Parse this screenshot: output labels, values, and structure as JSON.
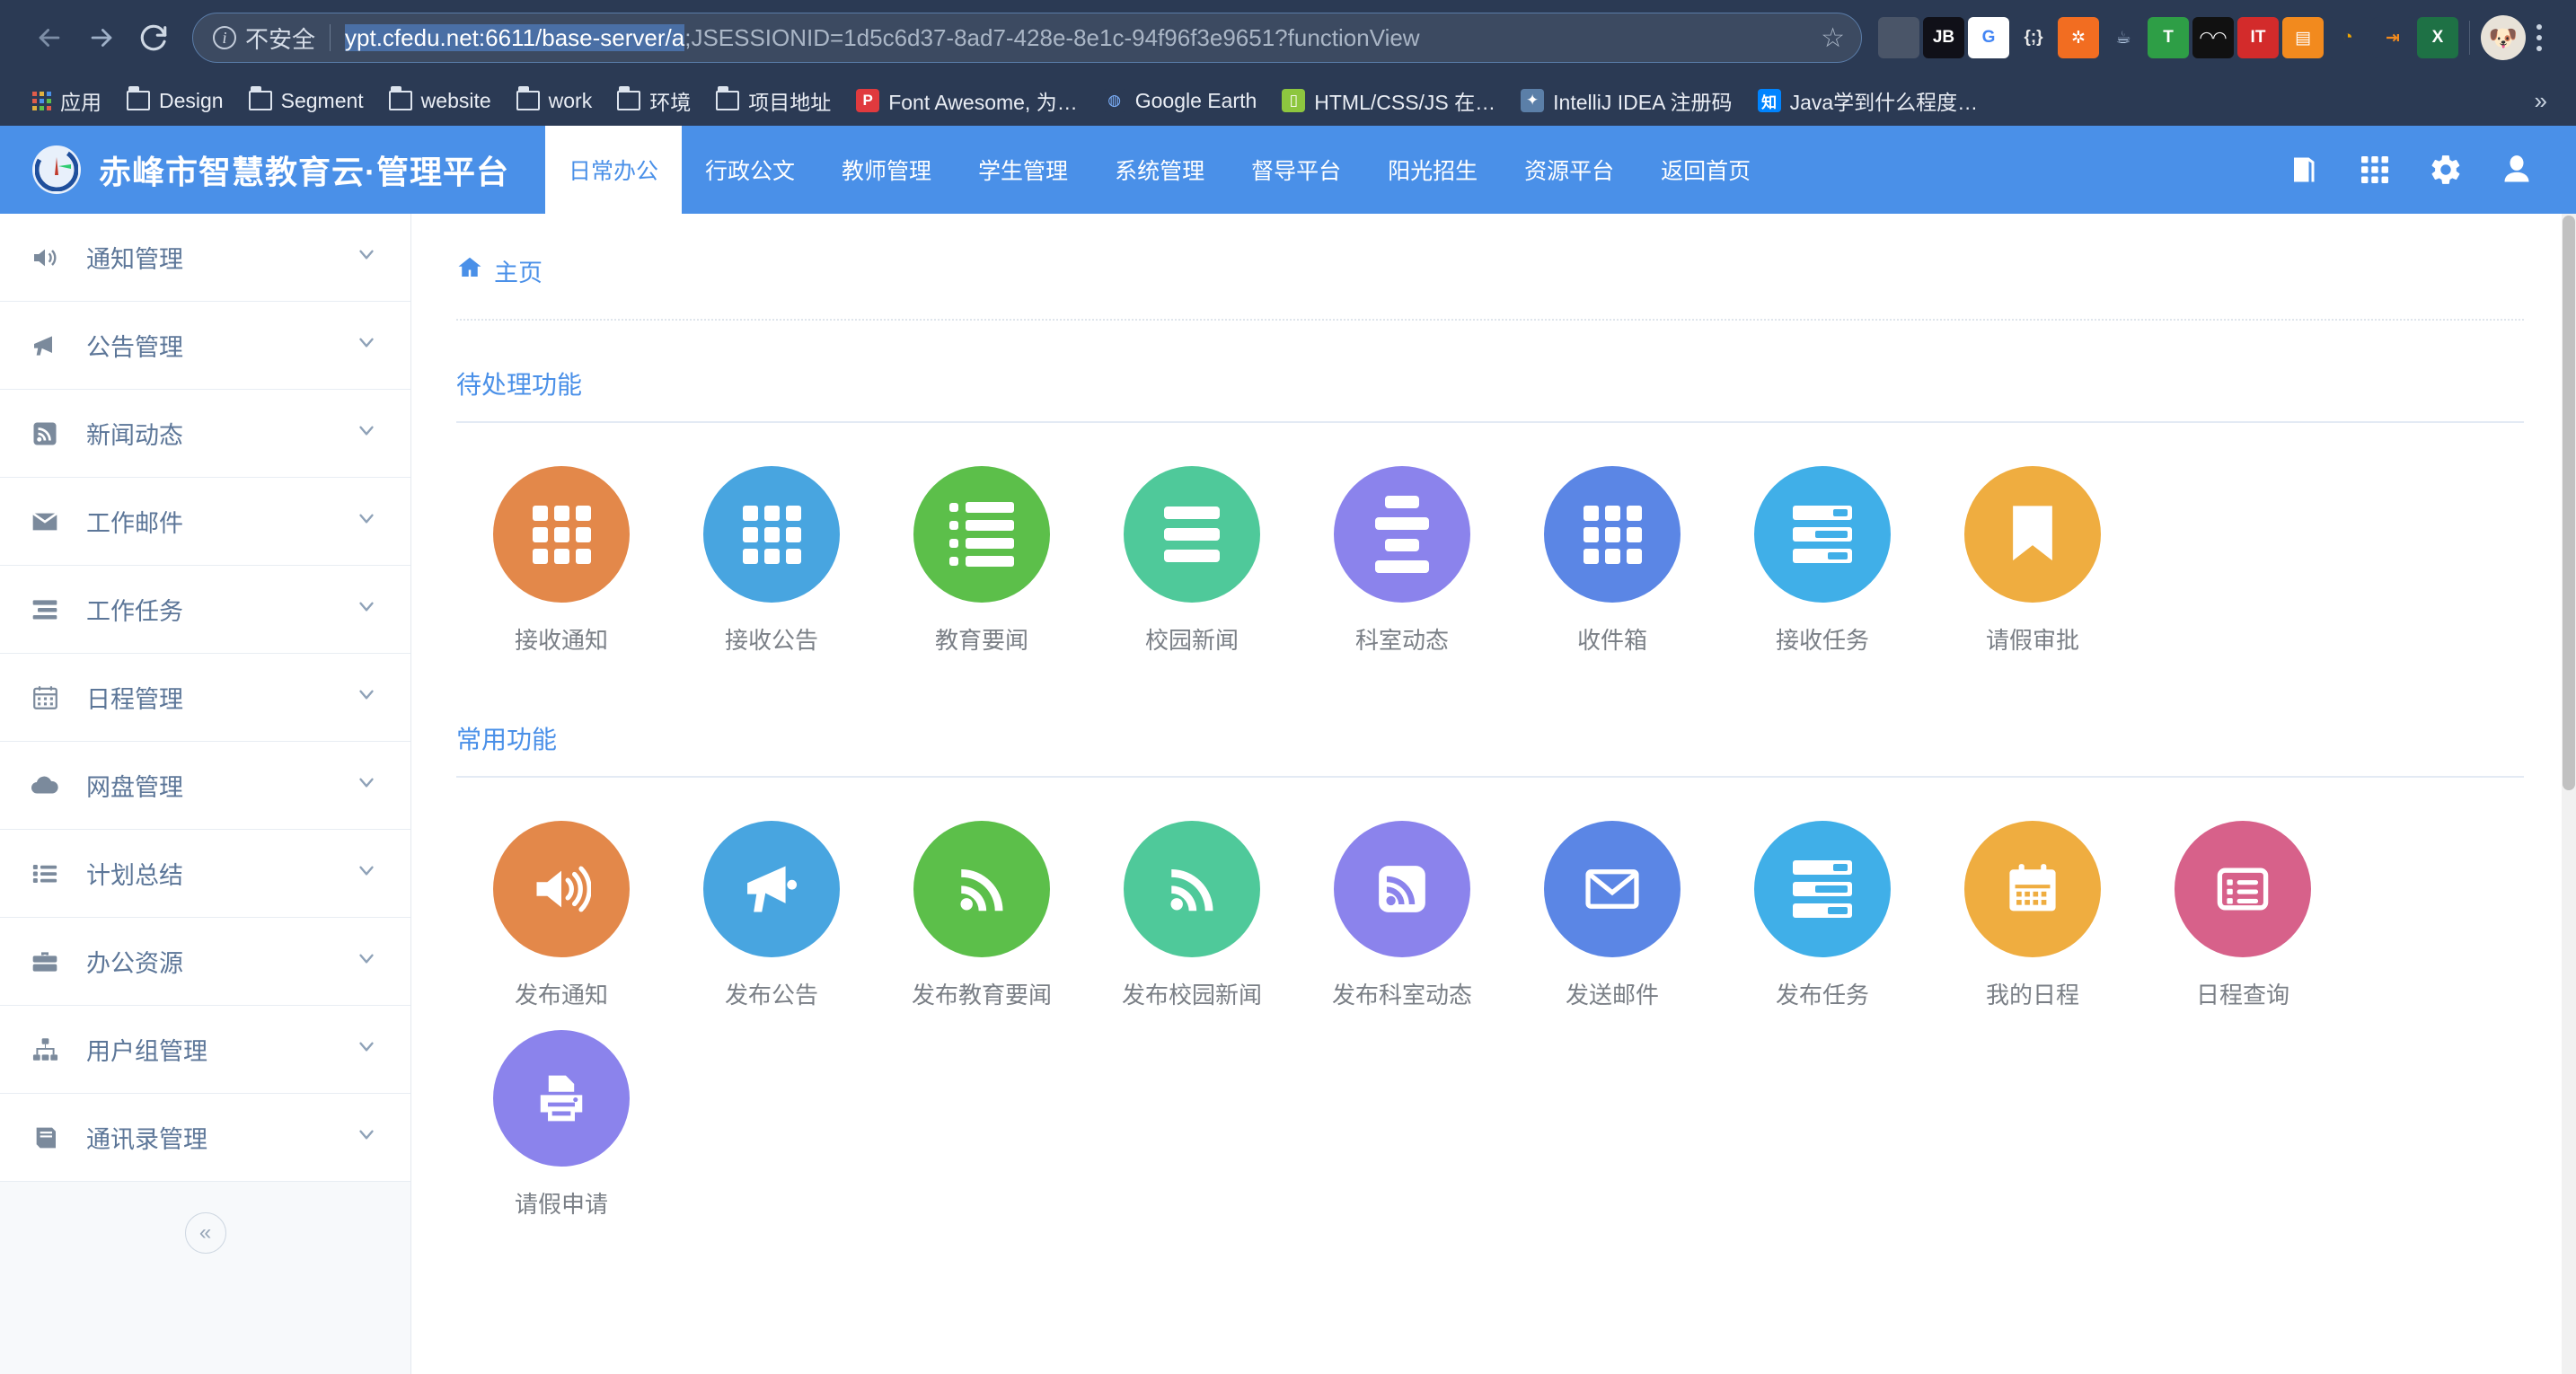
{
  "browser": {
    "nav": {
      "back": "back-arrow",
      "forward": "forward-arrow",
      "reload": "reload"
    },
    "security_label": "不安全",
    "url_selected": "ypt.cfedu.net:6611/base-server/a",
    "url_rest": ";JSESSIONID=1d5c6d37-8ad7-428e-8e1c-94f96f3e9651?functionView",
    "star": "☆",
    "extensions": [
      {
        "name": "pocket-extension",
        "glyph": "",
        "bg": "#4a5568",
        "fg": "#ff6b35"
      },
      {
        "name": "jetbrains-toolbox-extension",
        "glyph": "JB",
        "bg": "#101018",
        "fg": "#ffffff"
      },
      {
        "name": "google-translate-extension",
        "glyph": "G",
        "bg": "#ffffff",
        "fg": "#4285f4"
      },
      {
        "name": "json-viewer-extension",
        "glyph": "{;}",
        "bg": "#2b3a54",
        "fg": "#e8e8e8"
      },
      {
        "name": "octotree-extension",
        "glyph": "✲",
        "bg": "#f26d21",
        "fg": "#ffffff"
      },
      {
        "name": "java-extension",
        "glyph": "☕",
        "bg": "#2b3a54",
        "fg": "#bcd2ec"
      },
      {
        "name": "tampermonkey-extension",
        "glyph": "T",
        "bg": "#2e9e46",
        "fg": "#ffffff"
      },
      {
        "name": "oo-extension",
        "glyph": "◠◠",
        "bg": "#111111",
        "fg": "#ffffff"
      },
      {
        "name": "it-extension",
        "glyph": "IT",
        "bg": "#d32b2b",
        "fg": "#ffffff"
      },
      {
        "name": "table-capture-extension",
        "glyph": "▤",
        "bg": "#f28a1e",
        "fg": "#ffffff"
      },
      {
        "name": "color-picker-extension",
        "glyph": "◔",
        "bg": "#2b3a54",
        "fg": "#f0a500"
      },
      {
        "name": "redirect-extension",
        "glyph": "⇥",
        "bg": "#2b3a54",
        "fg": "#f28a1e"
      },
      {
        "name": "excel-extension",
        "glyph": "X",
        "bg": "#1e7145",
        "fg": "#ffffff"
      },
      {
        "name": "profile-avatar",
        "glyph": "🐶",
        "bg": "#e8e2d8",
        "fg": "#8b6b4a"
      }
    ],
    "bookmarks": [
      {
        "label": "应用",
        "icon": "apps-grid-icon"
      },
      {
        "label": "Design",
        "icon": "folder-icon"
      },
      {
        "label": "Segment",
        "icon": "folder-icon"
      },
      {
        "label": "website",
        "icon": "folder-icon"
      },
      {
        "label": "work",
        "icon": "folder-icon"
      },
      {
        "label": "环境",
        "icon": "folder-icon"
      },
      {
        "label": "项目地址",
        "icon": "folder-icon"
      },
      {
        "label": "Font Awesome, 为…",
        "icon": "favicon-p",
        "favbg": "#e03a3e",
        "favfg": "#ffffff",
        "favglyph": "P"
      },
      {
        "label": "Google Earth",
        "icon": "favicon-globe",
        "favbg": "#2b3a54",
        "favfg": "#7fb3ff",
        "favglyph": "◍"
      },
      {
        "label": "HTML/CSS/JS 在…",
        "icon": "favicon-bottle",
        "favbg": "#8dc63f",
        "favfg": "#ffffff",
        "favglyph": "▯"
      },
      {
        "label": "IntelliJ IDEA 注册码",
        "icon": "favicon-circle",
        "favbg": "#5b7fa8",
        "favfg": "#ffffff",
        "favglyph": "✦"
      },
      {
        "label": "Java学到什么程度…",
        "icon": "favicon-zhihu",
        "favbg": "#0084ff",
        "favfg": "#ffffff",
        "favglyph": "知"
      }
    ],
    "overflow_chevron": "»"
  },
  "app": {
    "brand_title": "赤峰市智慧教育云·管理平台",
    "accent_color": "#4a90e8",
    "nav_tabs": [
      {
        "label": "日常办公",
        "active": true
      },
      {
        "label": "行政公文",
        "active": false
      },
      {
        "label": "教师管理",
        "active": false
      },
      {
        "label": "学生管理",
        "active": false
      },
      {
        "label": "系统管理",
        "active": false
      },
      {
        "label": "督导平台",
        "active": false
      },
      {
        "label": "阳光招生",
        "active": false
      },
      {
        "label": "资源平台",
        "active": false
      },
      {
        "label": "返回首页",
        "active": false
      }
    ],
    "header_icons": [
      {
        "name": "book-icon"
      },
      {
        "name": "grid-apps-icon"
      },
      {
        "name": "gear-icon"
      },
      {
        "name": "user-icon"
      }
    ]
  },
  "sidebar": {
    "items": [
      {
        "label": "通知管理",
        "icon": "volume-icon"
      },
      {
        "label": "公告管理",
        "icon": "megaphone-icon"
      },
      {
        "label": "新闻动态",
        "icon": "rss-square-icon"
      },
      {
        "label": "工作邮件",
        "icon": "envelope-icon"
      },
      {
        "label": "工作任务",
        "icon": "tasks-icon"
      },
      {
        "label": "日程管理",
        "icon": "calendar-icon"
      },
      {
        "label": "网盘管理",
        "icon": "cloud-icon"
      },
      {
        "label": "计划总结",
        "icon": "list-icon"
      },
      {
        "label": "办公资源",
        "icon": "briefcase-icon"
      },
      {
        "label": "用户组管理",
        "icon": "sitemap-icon"
      },
      {
        "label": "通讯录管理",
        "icon": "address-book-icon"
      }
    ],
    "collapse_glyph": "«"
  },
  "main": {
    "breadcrumb": {
      "icon": "home-icon",
      "label": "主页"
    },
    "sections": [
      {
        "title": "待处理功能",
        "tiles": [
          {
            "label": "接收通知",
            "color": "#e3884a",
            "icon": "grid-9-icon"
          },
          {
            "label": "接收公告",
            "color": "#48a5e0",
            "icon": "grid-9-icon"
          },
          {
            "label": "教育要闻",
            "color": "#5cbf4a",
            "icon": "list-ul-icon"
          },
          {
            "label": "校园新闻",
            "color": "#4fc99a",
            "icon": "bars-icon"
          },
          {
            "label": "科室动态",
            "color": "#8b83ec",
            "icon": "align-center-icon"
          },
          {
            "label": "收件箱",
            "color": "#5b86e5",
            "icon": "grid-9-icon"
          },
          {
            "label": "接收任务",
            "color": "#40afe8",
            "icon": "tasks-icon"
          },
          {
            "label": "请假审批",
            "color": "#efad40",
            "icon": "bookmark-icon"
          }
        ]
      },
      {
        "title": "常用功能",
        "tiles": [
          {
            "label": "发布通知",
            "color": "#e3884a",
            "icon": "volume-up-icon"
          },
          {
            "label": "发布公告",
            "color": "#48a5e0",
            "icon": "megaphone-icon"
          },
          {
            "label": "发布教育要闻",
            "color": "#5cbf4a",
            "icon": "rss-icon"
          },
          {
            "label": "发布校园新闻",
            "color": "#4fc99a",
            "icon": "rss-icon"
          },
          {
            "label": "发布科室动态",
            "color": "#8b83ec",
            "icon": "rss-square-icon"
          },
          {
            "label": "发送邮件",
            "color": "#5b86e5",
            "icon": "envelope-icon"
          },
          {
            "label": "发布任务",
            "color": "#40afe8",
            "icon": "tasks-icon"
          },
          {
            "label": "我的日程",
            "color": "#efad40",
            "icon": "calendar-icon"
          },
          {
            "label": "日程查询",
            "color": "#d7618a",
            "icon": "list-alt-icon"
          },
          {
            "label": "请假申请",
            "color": "#8b83ec",
            "icon": "print-icon"
          }
        ]
      }
    ]
  }
}
